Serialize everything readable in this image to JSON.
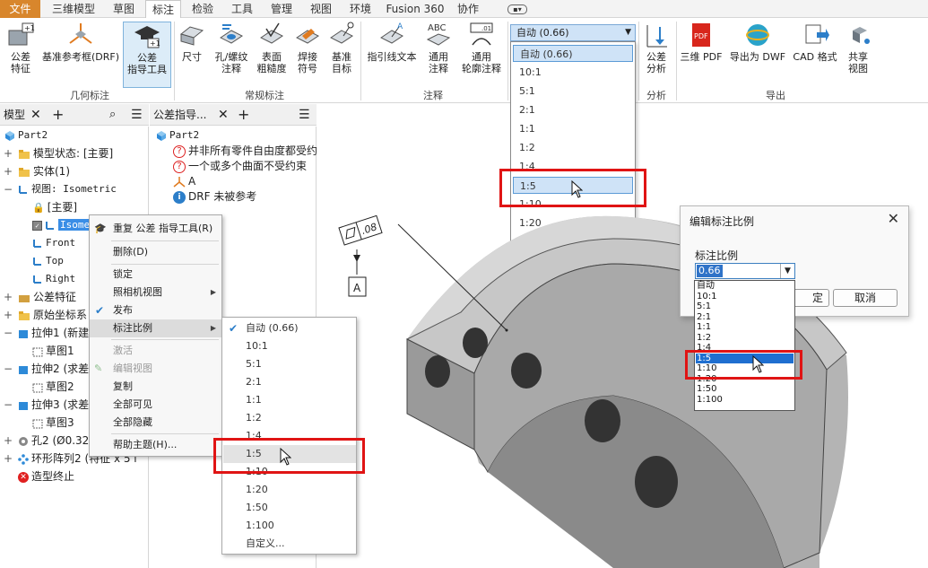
{
  "tabs": [
    "文件",
    "三维模型",
    "草图",
    "标注",
    "检验",
    "工具",
    "管理",
    "视图",
    "环境",
    "Fusion 360",
    "协作"
  ],
  "ribbon": {
    "groups": [
      "几何标注",
      "常规标注",
      "注释",
      "分析",
      "导出"
    ],
    "tolerance_feature": [
      "公差",
      "特征"
    ],
    "datum_frame": [
      "基准参考框(DRF)"
    ],
    "tol_advisor": [
      "公差",
      "指导工具"
    ],
    "dimension": [
      "尺寸"
    ],
    "hole_thread": [
      "孔/螺纹",
      "注释"
    ],
    "surface": [
      "表面",
      "粗糙度"
    ],
    "weld": [
      "焊接",
      "符号"
    ],
    "datum_target": [
      "基准",
      "目标"
    ],
    "leader_text": [
      "指引线文本"
    ],
    "general_note": [
      "通用",
      "注释"
    ],
    "general_profile": [
      "通用",
      "轮廓注释"
    ],
    "tol_analysis": [
      "公差",
      "分析"
    ],
    "pdf3d": [
      "三维 PDF"
    ],
    "dwf": [
      "导出为 DWF"
    ],
    "cad_format": [
      "CAD 格式"
    ],
    "share_view": [
      "共享",
      "视图"
    ]
  },
  "scale_combo": {
    "value": "自动 (0.66)"
  },
  "scale_options": [
    "自动 (0.66)",
    "10:1",
    "5:1",
    "2:1",
    "1:1",
    "1:2",
    "1:4",
    "1:5",
    "1:10",
    "1:20",
    "1:50",
    "1:100",
    "自定义..."
  ],
  "browser": {
    "tab": "模型",
    "items": {
      "part": "Part2",
      "model_state": "模型状态: [主要]",
      "solid": "实体(1)",
      "view": "视图: Isometric",
      "primary": "[主要]",
      "isometric": "Isome",
      "front": "Front",
      "top": "Top",
      "right": "Right",
      "tol_feature": "公差特征",
      "origin": "原始坐标系",
      "extrude1": "拉伸1 (新建",
      "sketch1": "草图1",
      "extrude2": "拉伸2 (求差",
      "sketch2": "草图2",
      "extrude3": "拉伸3 (求差",
      "sketch3": "草图3",
      "hole2": "孔2 (Ø0.325",
      "pattern2": "环形阵列2 (特征 x 5 i",
      "end": "造型终止"
    }
  },
  "advisor": {
    "tab": "公差指导...",
    "part": "Part2",
    "msg1": "并非所有零件自由度都受约",
    "msg2": "一个或多个曲面不受约束",
    "datum": "A",
    "drf": "DRF 未被参考"
  },
  "context_menu": {
    "items": [
      "重复 公差 指导工具(R)",
      "删除(D)",
      "锁定",
      "照相机视图",
      "发布",
      "标注比例",
      "激活",
      "编辑视图",
      "复制",
      "全部可见",
      "全部隐藏",
      "帮助主题(H)..."
    ]
  },
  "dialog": {
    "title": "编辑标注比例",
    "label": "标注比例",
    "value": "0.66",
    "ok": "定",
    "cancel": "取消",
    "list": [
      "自动",
      "10:1",
      "5:1",
      "2:1",
      "1:1",
      "1:2",
      "1:4",
      "1:5",
      "1:10",
      "1:20",
      "1:50",
      "1:100"
    ]
  },
  "annotation": {
    "tolerance": ".08",
    "datum": "A"
  },
  "colors": {
    "file_tab": "#d8862c",
    "highlight": "#cfe3f7",
    "select_blue": "#1f6fd0",
    "red_box": "#e01414"
  }
}
